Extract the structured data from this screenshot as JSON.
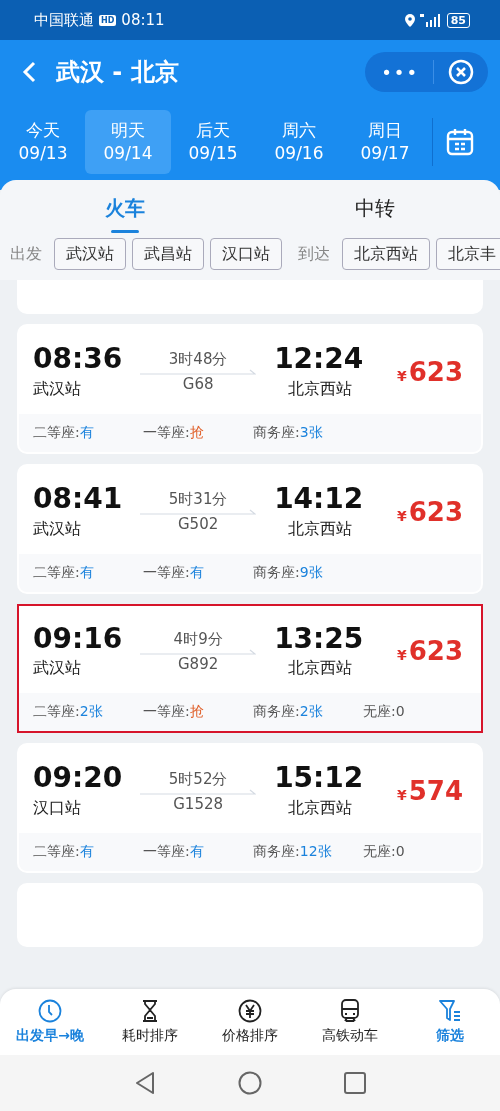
{
  "status_bar": {
    "carrier": "中国联通",
    "hd": "HD",
    "time": "08:11",
    "battery": "85"
  },
  "header": {
    "title": "武汉 - 北京",
    "more": "•••"
  },
  "date_tabs": [
    {
      "day": "今天",
      "date": "09/13",
      "selected": false
    },
    {
      "day": "明天",
      "date": "09/14",
      "selected": true
    },
    {
      "day": "后天",
      "date": "09/15",
      "selected": false
    },
    {
      "day": "周六",
      "date": "09/16",
      "selected": false
    },
    {
      "day": "周日",
      "date": "09/17",
      "selected": false
    }
  ],
  "mode_tabs": [
    {
      "label": "火车",
      "selected": true
    },
    {
      "label": "中转",
      "selected": false
    }
  ],
  "station_filter": {
    "depart_label": "出发",
    "depart": [
      "武汉站",
      "武昌站",
      "汉口站"
    ],
    "arrive_label": "到达",
    "arrive": [
      "北京西站",
      "北京丰"
    ]
  },
  "trains": [
    {
      "depart_time": "08:36",
      "depart_station": "武汉站",
      "duration": "3时48分",
      "number": "G68",
      "arrive_time": "12:24",
      "arrive_station": "北京西站",
      "currency": "¥",
      "price": "623",
      "selected": false,
      "seats": [
        {
          "name": "二等座:",
          "value": "有",
          "kind": "available"
        },
        {
          "name": "一等座:",
          "value": "抢",
          "kind": "grab"
        },
        {
          "name": "商务座:",
          "value": "3张",
          "kind": "available"
        }
      ]
    },
    {
      "depart_time": "08:41",
      "depart_station": "武汉站",
      "duration": "5时31分",
      "number": "G502",
      "arrive_time": "14:12",
      "arrive_station": "北京西站",
      "currency": "¥",
      "price": "623",
      "selected": false,
      "seats": [
        {
          "name": "二等座:",
          "value": "有",
          "kind": "available"
        },
        {
          "name": "一等座:",
          "value": "有",
          "kind": "available"
        },
        {
          "name": "商务座:",
          "value": "9张",
          "kind": "available"
        }
      ]
    },
    {
      "depart_time": "09:16",
      "depart_station": "武汉站",
      "duration": "4时9分",
      "number": "G892",
      "arrive_time": "13:25",
      "arrive_station": "北京西站",
      "currency": "¥",
      "price": "623",
      "selected": true,
      "seats": [
        {
          "name": "二等座:",
          "value": "2张",
          "kind": "available"
        },
        {
          "name": "一等座:",
          "value": "抢",
          "kind": "grab"
        },
        {
          "name": "商务座:",
          "value": "2张",
          "kind": "available"
        },
        {
          "name": "无座:",
          "value": "0",
          "kind": "none"
        }
      ]
    },
    {
      "depart_time": "09:20",
      "depart_station": "汉口站",
      "duration": "5时52分",
      "number": "G1528",
      "arrive_time": "15:12",
      "arrive_station": "北京西站",
      "currency": "¥",
      "price": "574",
      "selected": false,
      "seats": [
        {
          "name": "二等座:",
          "value": "有",
          "kind": "available"
        },
        {
          "name": "一等座:",
          "value": "有",
          "kind": "available"
        },
        {
          "name": "商务座:",
          "value": "12张",
          "kind": "available"
        },
        {
          "name": "无座:",
          "value": "0",
          "kind": "none"
        }
      ]
    }
  ],
  "bottom_nav": [
    {
      "label": "出发早→晚",
      "kind": "clock",
      "selected": true
    },
    {
      "label": "耗时排序",
      "kind": "hourglass",
      "selected": false
    },
    {
      "label": "价格排序",
      "kind": "yen",
      "selected": false
    },
    {
      "label": "高铁动车",
      "kind": "train",
      "selected": false
    },
    {
      "label": "筛选",
      "kind": "filter",
      "selected": true
    }
  ]
}
